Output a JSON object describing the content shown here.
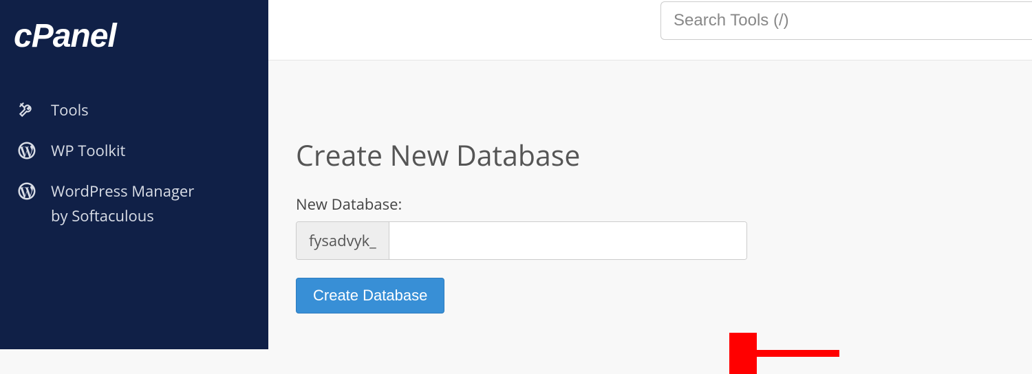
{
  "sidebar": {
    "items": [
      {
        "label": "Tools"
      },
      {
        "label": "WP Toolkit"
      },
      {
        "label_line1": "WordPress Manager",
        "label_line2": "by Softaculous"
      }
    ]
  },
  "header": {
    "search_placeholder": "Search Tools (/)"
  },
  "main": {
    "title": "Create New Database",
    "field_label": "New Database:",
    "prefix": "fysadvyk_",
    "create_button": "Create Database"
  }
}
